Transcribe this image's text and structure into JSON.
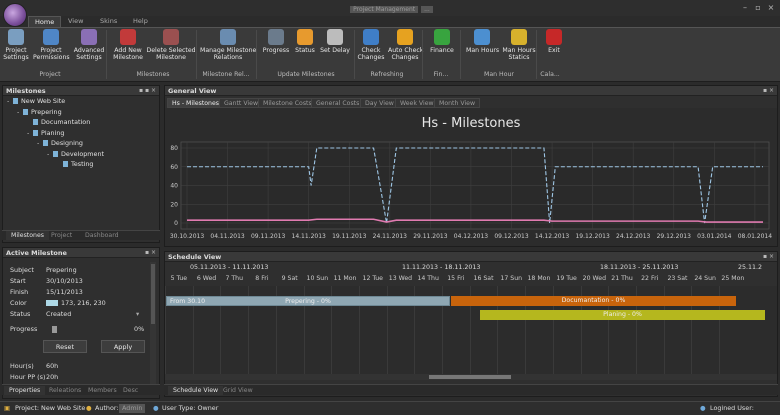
{
  "app": {
    "title": "Project Management",
    "title_badge": "..."
  },
  "ribbon": {
    "tabs": [
      "Home",
      "View",
      "Skins",
      "Help"
    ],
    "buttons": [
      {
        "label": "Project\nSettings",
        "icon": "gear-icon",
        "color": "#7a9ec0"
      },
      {
        "label": "Project\nPermissions",
        "icon": "people-icon",
        "color": "#4f86c6"
      },
      {
        "label": "Advanced\nSettings",
        "icon": "umbrella-icon",
        "color": "#8a6fb5"
      },
      {
        "label": "Add New\nMilestone",
        "icon": "flag-icon",
        "color": "#c23a3a"
      },
      {
        "label": "Delete Selected\nMilestone",
        "icon": "flag-remove-icon",
        "color": "#9b5050"
      },
      {
        "label": "Manage Milestone\nRelations",
        "icon": "relations-icon",
        "color": "#6a8cb0"
      },
      {
        "label": "Progress",
        "icon": "speedometer-icon",
        "color": "#6b7b8c"
      },
      {
        "label": "Status",
        "icon": "lightbulb-icon",
        "color": "#e79a2e"
      },
      {
        "label": "Set Delay",
        "icon": "stopwatch-icon",
        "color": "#bcbcbc"
      },
      {
        "label": "Check\nChanges",
        "icon": "refresh-icon",
        "color": "#3f7ec7"
      },
      {
        "label": "Auto Check\nChanges",
        "icon": "wifi-icon",
        "color": "#e6a220"
      },
      {
        "label": "Finance",
        "icon": "dollar-icon",
        "color": "#38a43f"
      },
      {
        "label": "Man Hours",
        "icon": "clock-icon",
        "color": "#4c8fd0"
      },
      {
        "label": "Man Hours\nStatics",
        "icon": "bars-icon",
        "color": "#d7b12c"
      },
      {
        "label": "Exit",
        "icon": "power-icon",
        "color": "#c62828"
      }
    ],
    "groups": [
      "Project",
      "Milestones",
      "Milestone Rel...",
      "Update Milestones",
      "Refreshing",
      "Fin...",
      "Man Hour",
      "Cala..."
    ]
  },
  "milestones_panel": {
    "title": "Milestones",
    "tree": [
      {
        "label": "New Web Site",
        "level": 0,
        "expander": "-"
      },
      {
        "label": "Prepering",
        "level": 1,
        "expander": "-"
      },
      {
        "label": "Documantation",
        "level": 2,
        "expander": ""
      },
      {
        "label": "Planing",
        "level": 2,
        "expander": "-"
      },
      {
        "label": "Designing",
        "level": 3,
        "expander": "-"
      },
      {
        "label": "Development",
        "level": 4,
        "expander": "-"
      },
      {
        "label": "Testing",
        "level": 5,
        "expander": ""
      }
    ],
    "tabs": [
      "Milestones",
      "Project",
      "Dashboard"
    ]
  },
  "active_milestone": {
    "title": "Active Milestone",
    "fields": [
      {
        "label": "Subject",
        "value": "Prepering"
      },
      {
        "label": "Start",
        "value": "30/10/2013"
      },
      {
        "label": "Finish",
        "value": "15/11/2013"
      },
      {
        "label": "Color",
        "value": "173, 216, 230"
      },
      {
        "label": "Status",
        "value": "Created"
      }
    ],
    "progress_label": "Progress",
    "progress_value": "0%",
    "reset": "Reset",
    "apply": "Apply",
    "hours_label": "Hour(s)",
    "hours_value": "60h",
    "hourpp_label": "Hour PP (s)",
    "hourpp_value": "20h",
    "tabs": [
      "Properties",
      "Releations",
      "Members",
      "Desc"
    ],
    "swatch": "#add8e6"
  },
  "general_view": {
    "title": "General View",
    "tabs": [
      "Hs - Milestones",
      "Gantt View",
      "Milestone Costs",
      "General Costs",
      "Day View",
      "Week View",
      "Month View"
    ],
    "chart_title": "Hs - Milestones"
  },
  "chart_data": {
    "type": "line",
    "title": "Hs - Milestones",
    "ylim": [
      0,
      80
    ],
    "yticks": [
      "80",
      "60",
      "40",
      "20",
      "0"
    ],
    "xticks": [
      "30.10.2013",
      "04.11.2013",
      "09.11.2013",
      "14.11.2013",
      "19.11.2013",
      "24.11.2013",
      "29.11.2013",
      "04.12.2013",
      "09.12.2013",
      "14.12.2013",
      "19.12.2013",
      "24.12.2013",
      "29.12.2013",
      "03.01.2014",
      "08.01.2014"
    ],
    "series": [
      {
        "name": "",
        "color": "#9fc7e6",
        "dashed": true,
        "points": [
          [
            0,
            60
          ],
          [
            15,
            60
          ],
          [
            15.3,
            40
          ],
          [
            16,
            80
          ],
          [
            23,
            80
          ],
          [
            24.6,
            0
          ],
          [
            25.8,
            80
          ],
          [
            44,
            80
          ],
          [
            44.7,
            0
          ],
          [
            45.4,
            60
          ],
          [
            63,
            60
          ],
          [
            63.8,
            0
          ],
          [
            64.8,
            60
          ],
          [
            71,
            60
          ]
        ]
      },
      {
        "name": "",
        "color": "#e07bb0",
        "dashed": false,
        "points": [
          [
            0,
            3
          ],
          [
            15,
            3
          ],
          [
            16,
            4
          ],
          [
            23,
            4
          ],
          [
            24.6,
            1
          ],
          [
            25.8,
            3
          ],
          [
            44,
            3
          ],
          [
            45,
            2
          ],
          [
            63,
            2
          ],
          [
            64,
            1
          ],
          [
            71,
            1
          ]
        ]
      }
    ]
  },
  "schedule": {
    "title": "Schedule View",
    "weeks": [
      "05.11.2013 - 11.11.2013",
      "11.11.2013 - 18.11.2013",
      "18.11.2013 - 25.11.2013",
      "25.11.2"
    ],
    "days": [
      "5 Tue",
      "6 Wed",
      "7 Thu",
      "8 Fri",
      "9 Sat",
      "10 Sun",
      "11 Mon",
      "12 Tue",
      "13 Wed",
      "14 Thu",
      "15 Fri",
      "16 Sat",
      "17 Sun",
      "18 Mon",
      "19 Tue",
      "20 Wed",
      "21 Thu",
      "22 Fri",
      "23 Sat",
      "24 Sun",
      "25 Mon"
    ],
    "from_label": "From 30.10",
    "bars": [
      {
        "label": "Prepering - 0%",
        "color": "#8fa7b3"
      },
      {
        "label": "Documantation - 0%",
        "color": "#c8640c"
      },
      {
        "label": "Planing - 0%",
        "color": "#b5b71e"
      }
    ],
    "tabs": [
      "Schedule View",
      "Grid View"
    ]
  },
  "status": {
    "project": "Project: New Web Site",
    "author_label": "Author:",
    "author_value": "Admin",
    "usertype": "User Type: Owner",
    "loggined": "Logined User:"
  }
}
